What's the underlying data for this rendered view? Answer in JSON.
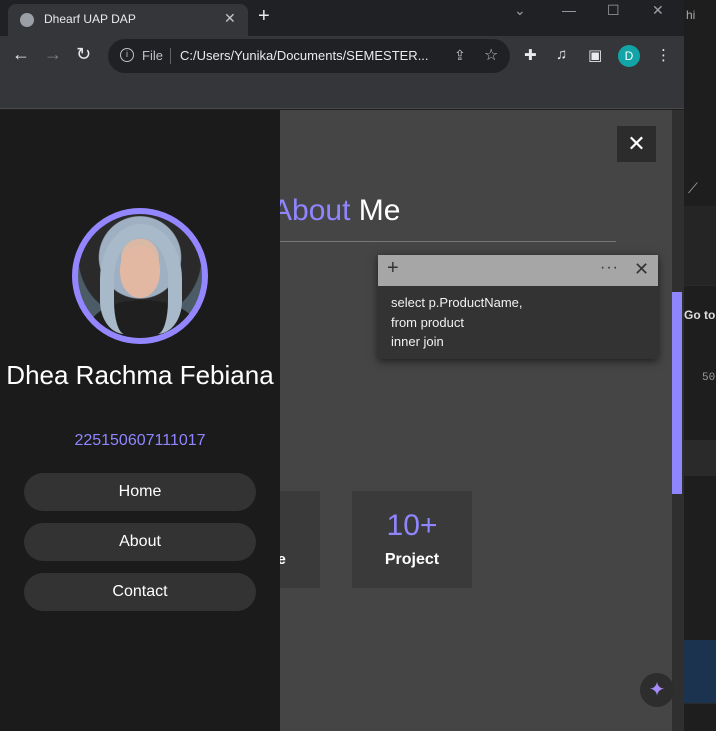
{
  "browser": {
    "tab_title": "Dhearf UAP DAP",
    "file_label": "File",
    "url": "C:/Users/Yunika/Documents/SEMESTER...",
    "profile_initial": "D",
    "accent": "#12a4a6"
  },
  "bg_app": {
    "fragment_1": "hi",
    "fragment_2": "Go to",
    "fragment_3": "50"
  },
  "sidebar": {
    "name": "Dhea Rachma Febiana",
    "nim": "225150607111017",
    "menu": [
      "Home",
      "About",
      "Contact"
    ]
  },
  "main": {
    "title_accent": "About",
    "title_rest": "Me",
    "card1_label": "nce",
    "card2_number": "10+",
    "card2_label": "Project",
    "close_symbol": "✕",
    "accent_color": "#8f86ff"
  },
  "note": {
    "lines": [
      "select p.ProductName,",
      "from product",
      "inner join"
    ]
  }
}
